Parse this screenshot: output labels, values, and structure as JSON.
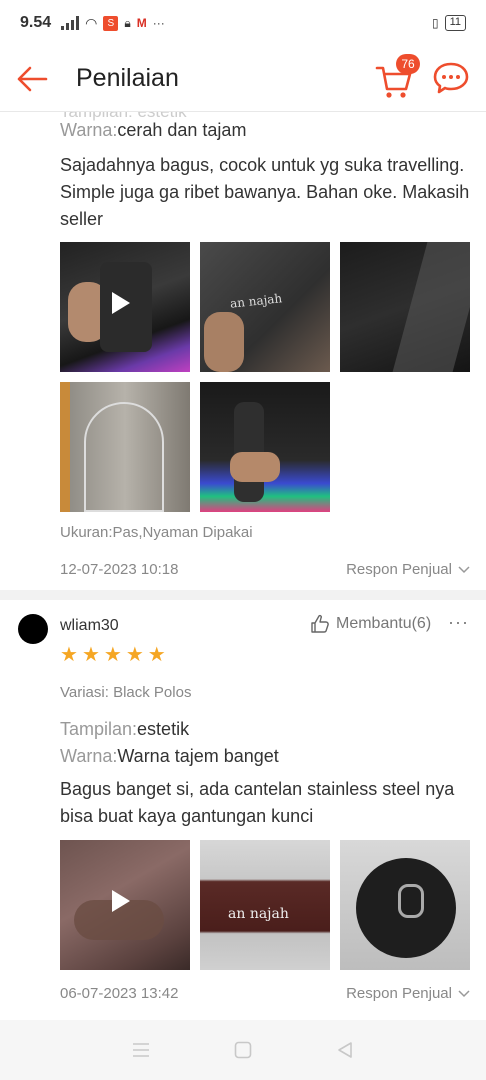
{
  "status_bar": {
    "time": "9.54",
    "battery": "11"
  },
  "header": {
    "title": "Penilaian",
    "cart_count": "76"
  },
  "review1": {
    "clipped_text": "Tampilan: estetik",
    "warna_label": "Warna:",
    "warna_value": "cerah dan tajam",
    "comment": "Sajadahnya bagus, cocok untuk yg suka travelling. Simple juga ga ribet bawanya. Bahan oke. Makasih seller",
    "ukuran": "Ukuran:Pas,Nyaman Dipakai",
    "date": "12-07-2023 10:18",
    "respon_label": "Respon Penjual"
  },
  "review2": {
    "username": "wliam30",
    "helpful_label": "Membantu(6)",
    "rating": 5,
    "variasi": "Variasi: Black Polos",
    "tampilan_label": "Tampilan:",
    "tampilan_value": "estetik",
    "warna_label": "Warna:",
    "warna_value": "Warna tajem banget",
    "comment": "Bagus banget si, ada cantelan stainless steel nya bisa buat kaya gantungan kunci",
    "date": "06-07-2023 13:42",
    "respon_label": "Respon Penjual"
  },
  "colors": {
    "accent": "#ee4d2d",
    "star": "#f5a623"
  },
  "icons": [
    "back-arrow-icon",
    "cart-icon",
    "chat-icon",
    "thumbs-up-icon",
    "more-icon",
    "play-icon",
    "chevron-down-icon"
  ]
}
